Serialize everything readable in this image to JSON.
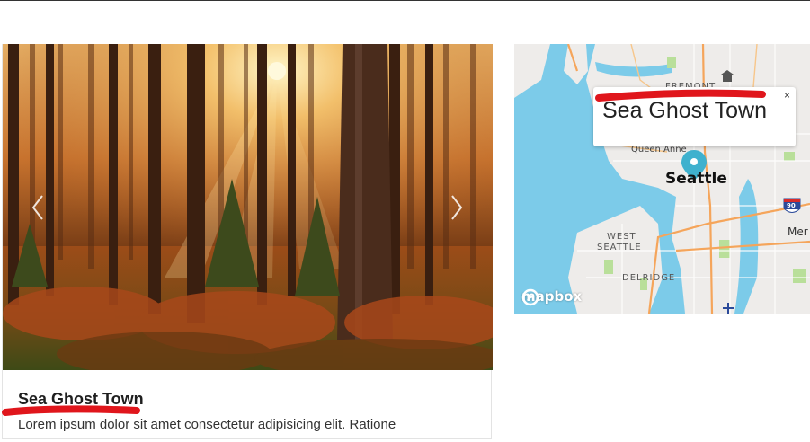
{
  "card": {
    "title": "Sea Ghost Town",
    "description": "Lorem ipsum dolor sit amet consectetur adipisicing elit. Ratione"
  },
  "carousel": {
    "image_alt": "Sunlit autumn forest",
    "prev_icon": "chevron-left-icon",
    "next_icon": "chevron-right-icon"
  },
  "map": {
    "popup_title": "Sea Ghost Town",
    "close_label": "×",
    "city_label": "Seattle",
    "neighborhoods": {
      "fremont": "FREMONT",
      "queen_anne": "Queen Anne",
      "west": "WEST",
      "seattle": "SEATTLE",
      "delridge": "DELRIDGE",
      "mer": "Mer"
    },
    "highway_shield": "90",
    "logo_text": "mapbox"
  },
  "colors": {
    "annotation_red": "#e0161c",
    "water": "#7ccbe9",
    "land": "#eeecea",
    "pin": "#3fb1ce"
  }
}
